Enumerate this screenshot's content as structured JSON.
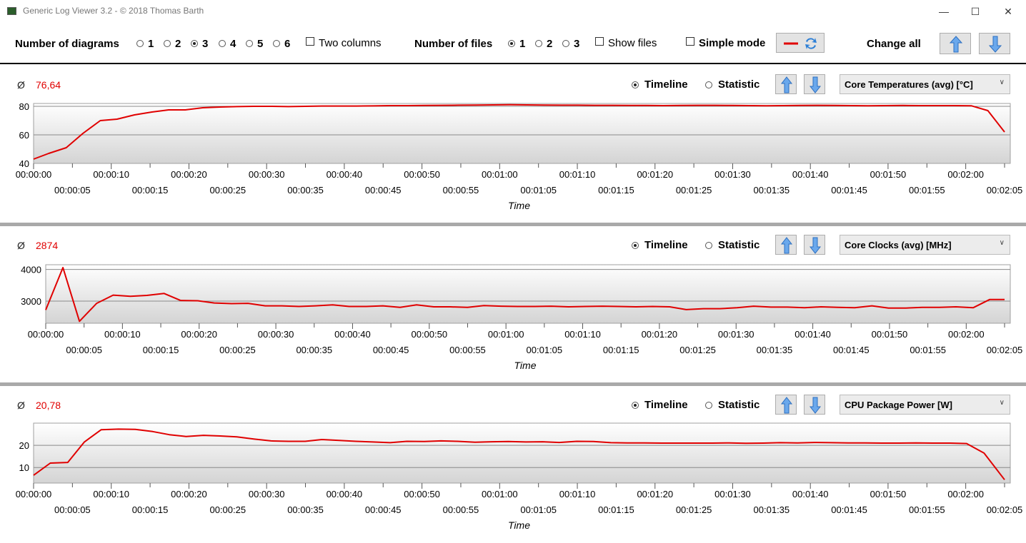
{
  "window": {
    "title": "Generic Log Viewer 3.2 - © 2018 Thomas Barth",
    "minimize": "—",
    "maximize": "☐",
    "close": "✕"
  },
  "toolbar": {
    "diagrams_label": "Number of diagrams",
    "diagram_options": [
      "1",
      "2",
      "3",
      "4",
      "5",
      "6"
    ],
    "diagrams_selected": "3",
    "two_columns_label": "Two columns",
    "files_label": "Number of files",
    "file_options": [
      "1",
      "2",
      "3"
    ],
    "files_selected": "1",
    "show_files_label": "Show files",
    "simple_mode_label": "Simple mode",
    "change_all_label": "Change all"
  },
  "panels": [
    {
      "avg_symbol": "Ø",
      "avg_value": "76,64",
      "timeline_label": "Timeline",
      "statistic_label": "Statistic",
      "selected_mode": "Timeline",
      "sensor": "Core Temperatures (avg) [°C]"
    },
    {
      "avg_symbol": "Ø",
      "avg_value": "2874",
      "timeline_label": "Timeline",
      "statistic_label": "Statistic",
      "selected_mode": "Timeline",
      "sensor": "Core Clocks (avg) [MHz]"
    },
    {
      "avg_symbol": "Ø",
      "avg_value": "20,78",
      "timeline_label": "Timeline",
      "statistic_label": "Statistic",
      "selected_mode": "Timeline",
      "sensor": "CPU Package Power [W]"
    }
  ],
  "colors": {
    "line": "#e00000",
    "avg_value": "#e00000",
    "button_arrow": "#4a90e2"
  },
  "chart_data": [
    {
      "type": "line",
      "xlabel": "Time",
      "ylabel": "",
      "ylim": [
        40,
        82
      ],
      "yticks": [
        40,
        60,
        80
      ],
      "xticks_top": [
        "00:00:00",
        "00:00:10",
        "00:00:20",
        "00:00:30",
        "00:00:40",
        "00:00:50",
        "00:01:00",
        "00:01:10",
        "00:01:20",
        "00:01:30",
        "00:01:40",
        "00:01:50",
        "00:02:00"
      ],
      "xticks_bottom": [
        "00:00:05",
        "00:00:15",
        "00:00:25",
        "00:00:35",
        "00:00:45",
        "00:00:55",
        "00:01:05",
        "00:01:15",
        "00:01:25",
        "00:01:35",
        "00:01:45",
        "00:01:55",
        "00:02:05"
      ],
      "xlim": [
        0,
        128
      ],
      "series": [
        {
          "x": [
            0,
            2,
            4.3,
            6.5,
            8.8,
            11,
            13.3,
            15.6,
            17.8,
            20,
            22.3,
            24.6,
            26.8,
            29,
            31.3,
            33.6,
            35.8,
            38,
            40.3,
            42.6,
            44.8,
            47,
            49.3,
            51.6,
            53.8,
            56,
            58.3,
            60.6,
            62.8,
            65,
            67.3,
            69.6,
            71.8,
            74,
            76.3,
            78.6,
            80.8,
            83,
            85.3,
            87.6,
            89.8,
            92,
            94.3,
            96.6,
            98.8,
            101,
            103.3,
            105.6,
            107.8,
            110,
            112.3,
            114.6,
            116.8,
            119,
            121.3,
            123.6,
            125.8,
            128
          ],
          "values": [
            43,
            47,
            51,
            61,
            70,
            71,
            74,
            76,
            77.5,
            77.5,
            79,
            79.5,
            79.8,
            80,
            80,
            79.8,
            80,
            80.2,
            80.2,
            80.2,
            80.3,
            80.5,
            80.5,
            80.6,
            80.7,
            80.8,
            80.9,
            81,
            81.1,
            81,
            80.9,
            80.8,
            80.8,
            80.7,
            80.7,
            80.6,
            80.6,
            80.5,
            80.6,
            80.7,
            80.7,
            80.6,
            80.5,
            80.4,
            80.5,
            80.6,
            80.7,
            80.6,
            80.5,
            80.4,
            80.5,
            80.6,
            80.5,
            80.5,
            80.5,
            80.4,
            77,
            62
          ]
        }
      ]
    },
    {
      "type": "line",
      "xlabel": "Time",
      "ylabel": "",
      "ylim": [
        2300,
        4150
      ],
      "yticks": [
        3000,
        4000
      ],
      "xticks_top": [
        "00:00:00",
        "00:00:10",
        "00:00:20",
        "00:00:30",
        "00:00:40",
        "00:00:50",
        "00:01:00",
        "00:01:10",
        "00:01:20",
        "00:01:30",
        "00:01:40",
        "00:01:50",
        "00:02:00"
      ],
      "xticks_bottom": [
        "00:00:05",
        "00:00:15",
        "00:00:25",
        "00:00:35",
        "00:00:45",
        "00:00:55",
        "00:01:05",
        "00:01:15",
        "00:01:25",
        "00:01:35",
        "00:01:45",
        "00:01:55",
        "00:02:05"
      ],
      "xlim": [
        0,
        128
      ],
      "series": [
        {
          "x": [
            0,
            2.3,
            4.5,
            6.8,
            9,
            11.3,
            13.5,
            15.8,
            18,
            20.3,
            22.5,
            24.8,
            27,
            29.3,
            31.5,
            33.8,
            36,
            38.3,
            40.5,
            42.8,
            45,
            47.3,
            49.5,
            51.8,
            54,
            56.3,
            58.5,
            60.8,
            63,
            65.3,
            67.5,
            69.8,
            72,
            74.3,
            76.5,
            78.8,
            81,
            83.3,
            85.5,
            87.8,
            90,
            92.3,
            94.5,
            96.8,
            99,
            101.3,
            103.5,
            105.8,
            108,
            110.3,
            112.5,
            114.8,
            117,
            119.3,
            121.5,
            123.8,
            126,
            128
          ],
          "values": [
            2720,
            4060,
            2360,
            2930,
            3190,
            3150,
            3180,
            3240,
            3020,
            3010,
            2940,
            2920,
            2930,
            2850,
            2850,
            2830,
            2850,
            2880,
            2830,
            2830,
            2850,
            2800,
            2880,
            2820,
            2820,
            2800,
            2860,
            2840,
            2830,
            2830,
            2840,
            2820,
            2830,
            2840,
            2830,
            2820,
            2830,
            2820,
            2730,
            2760,
            2760,
            2790,
            2840,
            2810,
            2810,
            2790,
            2820,
            2800,
            2790,
            2850,
            2780,
            2780,
            2800,
            2800,
            2820,
            2790,
            3050,
            3050
          ]
        }
      ]
    },
    {
      "type": "line",
      "xlabel": "Time",
      "ylabel": "",
      "ylim": [
        3,
        30
      ],
      "yticks": [
        10,
        20
      ],
      "xticks_top": [
        "00:00:00",
        "00:00:10",
        "00:00:20",
        "00:00:30",
        "00:00:40",
        "00:00:50",
        "00:01:00",
        "00:01:10",
        "00:01:20",
        "00:01:30",
        "00:01:40",
        "00:01:50",
        "00:02:00"
      ],
      "xticks_bottom": [
        "00:00:05",
        "00:00:15",
        "00:00:25",
        "00:00:35",
        "00:00:45",
        "00:00:55",
        "00:01:05",
        "00:01:15",
        "00:01:25",
        "00:01:35",
        "00:01:45",
        "00:01:55",
        "00:02:05"
      ],
      "xlim": [
        0,
        128
      ],
      "series": [
        {
          "x": [
            0,
            2.2,
            4.5,
            6.7,
            8.9,
            11.2,
            13.4,
            15.7,
            17.9,
            20.1,
            22.4,
            24.6,
            26.8,
            29.1,
            31.3,
            33.6,
            35.8,
            38,
            40.3,
            42.5,
            44.7,
            47,
            49.2,
            51.5,
            53.7,
            55.9,
            58.2,
            60.4,
            62.6,
            64.9,
            67.1,
            69.3,
            71.6,
            73.8,
            76.1,
            78.3,
            80.5,
            82.8,
            85,
            87.2,
            89.5,
            91.7,
            93.9,
            96.2,
            98.4,
            100.7,
            102.9,
            105.1,
            107.4,
            109.6,
            111.8,
            114.1,
            116.3,
            118.5,
            120.8,
            123,
            125.3,
            128
          ],
          "values": [
            6.5,
            12,
            12.3,
            21.5,
            27,
            27.3,
            27.2,
            26.2,
            24.8,
            24,
            24.5,
            24.2,
            23.8,
            22.8,
            22,
            21.8,
            21.8,
            22.6,
            22.2,
            21.8,
            21.5,
            21.2,
            21.8,
            21.7,
            22,
            21.8,
            21.4,
            21.6,
            21.7,
            21.5,
            21.6,
            21.3,
            21.8,
            21.7,
            21.2,
            21.1,
            21.1,
            21,
            21,
            21,
            21,
            21.1,
            20.9,
            21,
            21.2,
            21.1,
            21.3,
            21.2,
            21.1,
            21.1,
            21,
            21,
            21.1,
            21,
            21,
            20.8,
            16.5,
            4.5
          ]
        }
      ]
    }
  ]
}
